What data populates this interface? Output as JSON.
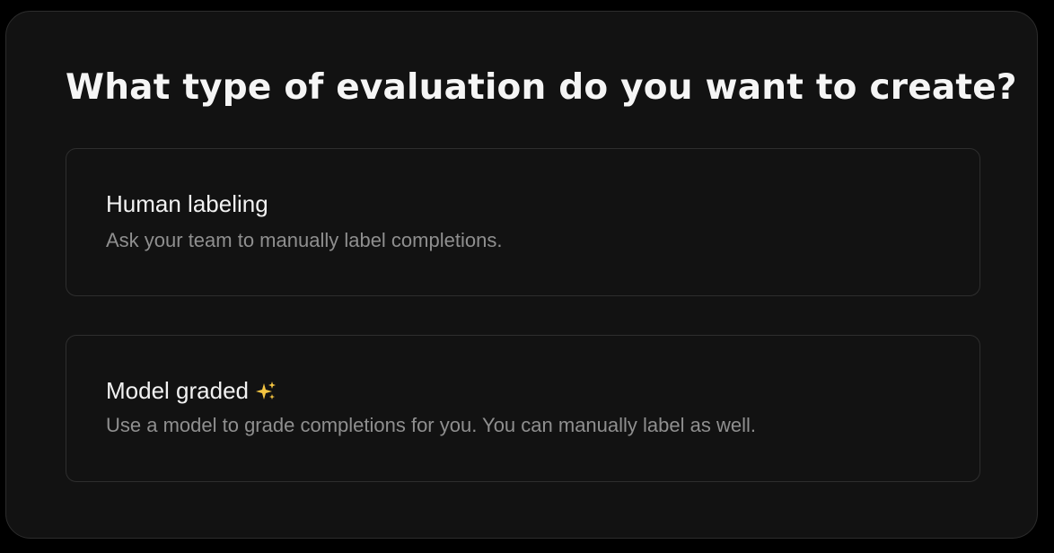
{
  "page": {
    "title": "What type of evaluation do you want to create?"
  },
  "options": [
    {
      "title": "Human labeling",
      "description": "Ask your team to manually label completions."
    },
    {
      "title": "Model graded",
      "icon": "sparkles-icon",
      "description": "Use a model to grade completions for you. You can manually label as well."
    }
  ],
  "colors": {
    "background": "#121212",
    "border": "#2e2e2e",
    "title_text": "#f5f5f5",
    "secondary_text": "#8f8f8f",
    "sparkle": "#f5c542"
  }
}
